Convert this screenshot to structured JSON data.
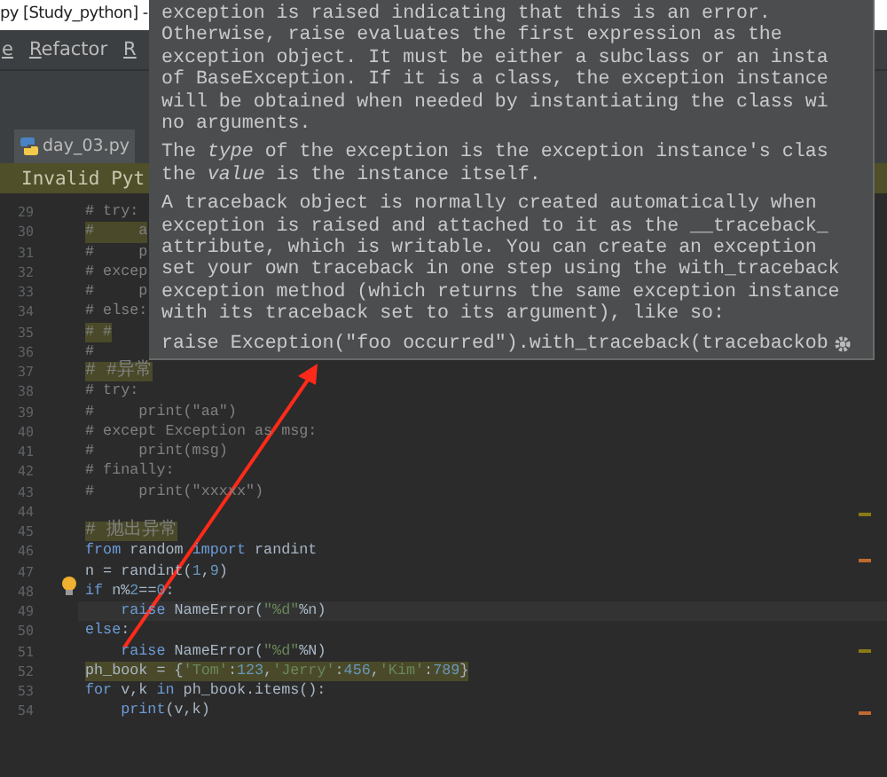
{
  "window": {
    "title": "py [Study_python] -"
  },
  "menu": [
    "e",
    "Refactor",
    "R"
  ],
  "tab": {
    "label": "day_03.py",
    "selected": true
  },
  "notification": {
    "text": "Invalid Pyt"
  },
  "editor": {
    "lines": [
      {
        "number": "29",
        "tokens": [
          {
            "text": "# try:",
            "kind": "com"
          }
        ]
      },
      {
        "number": "30",
        "highlighted": true,
        "tokens": [
          {
            "text": "#     a",
            "kind": "com"
          }
        ]
      },
      {
        "number": "31",
        "tokens": [
          {
            "text": "#     p",
            "kind": "com"
          }
        ]
      },
      {
        "number": "32",
        "tokens": [
          {
            "text": "# excep",
            "kind": "com"
          }
        ]
      },
      {
        "number": "33",
        "tokens": [
          {
            "text": "#     p",
            "kind": "com"
          }
        ]
      },
      {
        "number": "34",
        "tokens": [
          {
            "text": "# else:",
            "kind": "com"
          }
        ]
      },
      {
        "number": "35",
        "highlighted": true,
        "tokens": [
          {
            "text": "# #",
            "kind": "com"
          }
        ]
      },
      {
        "number": "36",
        "tokens": [
          {
            "text": "#",
            "kind": "com"
          }
        ]
      },
      {
        "number": "37",
        "highlighted": true,
        "tokens": [
          {
            "text": "# #异常",
            "kind": "com"
          }
        ]
      },
      {
        "number": "38",
        "tokens": [
          {
            "text": "# try:",
            "kind": "com"
          }
        ]
      },
      {
        "number": "39",
        "tokens": [
          {
            "text": "#     print(\"aa\")",
            "kind": "com"
          }
        ]
      },
      {
        "number": "40",
        "tokens": [
          {
            "text": "# except Exception as msg:",
            "kind": "com"
          }
        ]
      },
      {
        "number": "41",
        "tokens": [
          {
            "text": "#     print(msg)",
            "kind": "com"
          }
        ]
      },
      {
        "number": "42",
        "tokens": [
          {
            "text": "# finally:",
            "kind": "com"
          }
        ]
      },
      {
        "number": "43",
        "tokens": [
          {
            "text": "#     print(\"xxxxx\")",
            "kind": "com"
          }
        ]
      },
      {
        "number": "44"
      },
      {
        "number": "45",
        "highlighted": true,
        "tokens": [
          {
            "text": "# 抛出异常",
            "kind": "com"
          }
        ]
      },
      {
        "number": "46",
        "tokens": [
          {
            "text": "from ",
            "kind": "kw"
          },
          {
            "text": "random ",
            "kind": "plain"
          },
          {
            "text": "import ",
            "kind": "kw"
          },
          {
            "text": "randint",
            "kind": "plain"
          }
        ]
      },
      {
        "number": "47",
        "tokens": [
          {
            "text": "n = randint(",
            "kind": "plain"
          },
          {
            "text": "1",
            "kind": "num"
          },
          {
            "text": ",",
            "kind": "plain"
          },
          {
            "text": "9",
            "kind": "num"
          },
          {
            "text": ")",
            "kind": "plain"
          }
        ]
      },
      {
        "number": "48",
        "tokens": [
          {
            "text": "if ",
            "kind": "kw"
          },
          {
            "text": "n%",
            "kind": "plain"
          },
          {
            "text": "2",
            "kind": "num"
          },
          {
            "text": "==",
            "kind": "plain"
          },
          {
            "text": "0",
            "kind": "num"
          },
          {
            "text": ":",
            "kind": "plain"
          }
        ]
      },
      {
        "number": "49",
        "current": true,
        "tokens": [
          {
            "text": "    raise ",
            "kind": "kw"
          },
          {
            "text": "NameError(",
            "kind": "plain"
          },
          {
            "text": "\"%d\"",
            "kind": "str"
          },
          {
            "text": "%n)",
            "kind": "plain"
          }
        ]
      },
      {
        "number": "50",
        "tokens": [
          {
            "text": "else",
            "kind": "kw"
          },
          {
            "text": ":",
            "kind": "plain"
          }
        ]
      },
      {
        "number": "51",
        "tokens": [
          {
            "text": "    raise ",
            "kind": "kw"
          },
          {
            "text": "NameError(",
            "kind": "plain"
          },
          {
            "text": "\"%d\"",
            "kind": "str"
          },
          {
            "text": "%N)",
            "kind": "plain"
          }
        ]
      },
      {
        "number": "52",
        "highlighted": true,
        "tokens": [
          {
            "text": "ph_book = {",
            "kind": "plain"
          },
          {
            "text": "'Tom'",
            "kind": "str"
          },
          {
            "text": ":",
            "kind": "plain"
          },
          {
            "text": "123",
            "kind": "num"
          },
          {
            "text": ",",
            "kind": "plain"
          },
          {
            "text": "'Jerry'",
            "kind": "str"
          },
          {
            "text": ":",
            "kind": "plain"
          },
          {
            "text": "456",
            "kind": "num"
          },
          {
            "text": ",",
            "kind": "plain"
          },
          {
            "text": "'Kim'",
            "kind": "str"
          },
          {
            "text": ":",
            "kind": "plain"
          },
          {
            "text": "789",
            "kind": "num"
          },
          {
            "text": "}",
            "kind": "plain"
          }
        ]
      },
      {
        "number": "53",
        "tokens": [
          {
            "text": "for ",
            "kind": "kw"
          },
          {
            "text": "v,k ",
            "kind": "plain"
          },
          {
            "text": "in ",
            "kind": "kw"
          },
          {
            "text": "ph_book.items():",
            "kind": "plain"
          }
        ]
      },
      {
        "number": "54",
        "tokens": [
          {
            "text": "    print",
            "kind": "kw"
          },
          {
            "text": "(v,k)",
            "kind": "plain"
          }
        ]
      }
    ]
  },
  "tooltip": {
    "paragraphs": [
      "exception is raised indicating that this is an error.\nOtherwise, raise evaluates the first expression as the\nexception object. It must be either a subclass or an insta\nof BaseException. If it is a class, the exception instance\nwill be obtained when needed by instantiating the class wi\nno arguments.",
      "The *type* of the exception is the exception instance's clas\nthe *value* is the instance itself.",
      "A traceback object is normally created automatically when\nexception is raised and attached to it as the __traceback_\nattribute, which is writable. You can create an exception\nset your own traceback in one step using the with_traceback\nexception method (which returns the same exception instance\nwith its traceback set to its argument), like so:"
    ],
    "code": "raise Exception(\"foo occurred\").with_traceback(tracebackob"
  }
}
